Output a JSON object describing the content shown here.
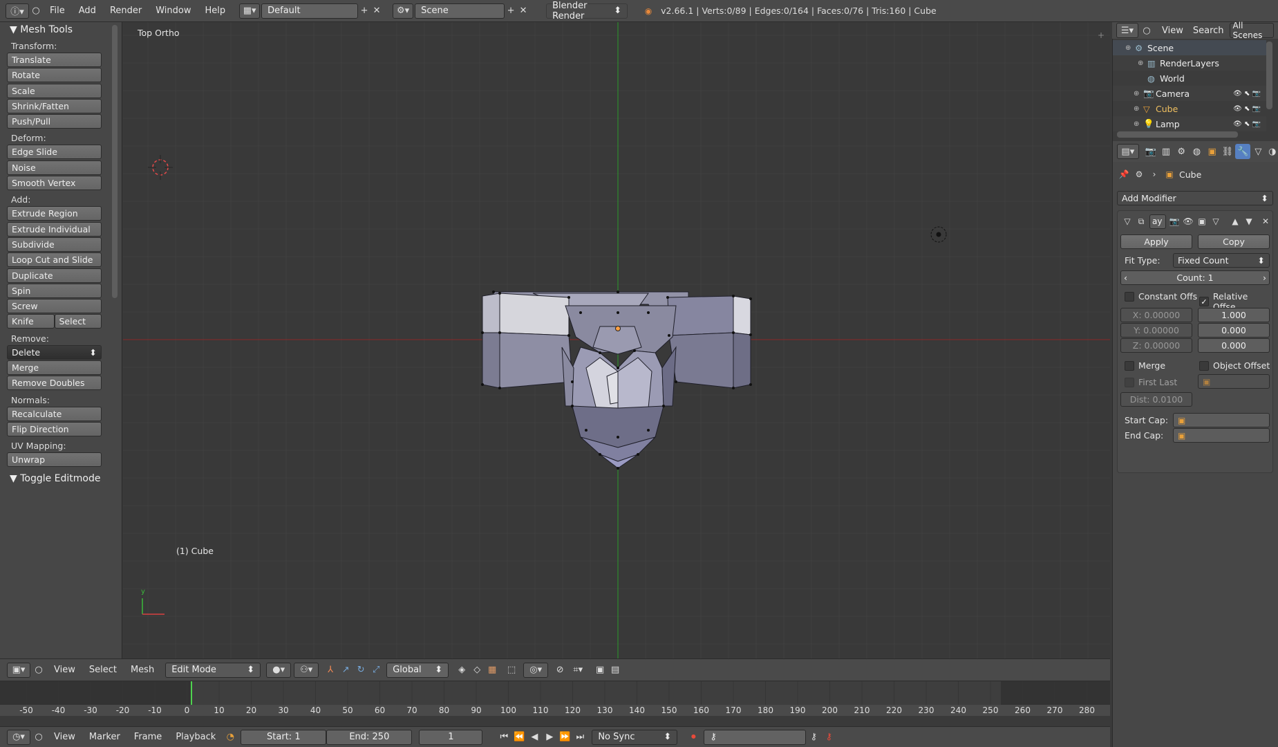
{
  "topbar": {
    "menus": [
      "File",
      "Add",
      "Render",
      "Window",
      "Help"
    ],
    "screen_layout": "Default",
    "scene": "Scene",
    "render_engine": "Blender Render",
    "stats": "v2.66.1 | Verts:0/89 | Edges:0/164 | Faces:0/76 | Tris:160 | Cube"
  },
  "toolshelf": {
    "title": "Mesh Tools",
    "sections": [
      {
        "label": "Transform:",
        "buttons": [
          "Translate",
          "Rotate",
          "Scale",
          "Shrink/Fatten",
          "Push/Pull"
        ]
      },
      {
        "label": "Deform:",
        "buttons": [
          "Edge Slide",
          "Noise",
          "Smooth Vertex"
        ]
      },
      {
        "label": "Add:",
        "buttons": [
          "Extrude Region",
          "Extrude Individual",
          "Subdivide",
          "Loop Cut and Slide",
          "Duplicate",
          "Spin",
          "Screw"
        ],
        "row": [
          "Knife",
          "Select"
        ]
      },
      {
        "label": "Remove:",
        "dropdown": "Delete",
        "buttons": [
          "Merge",
          "Remove Doubles"
        ]
      },
      {
        "label": "Normals:",
        "buttons": [
          "Recalculate",
          "Flip Direction"
        ]
      },
      {
        "label": "UV Mapping:",
        "buttons": [
          "Unwrap"
        ]
      }
    ],
    "footer": "Toggle Editmode"
  },
  "viewport": {
    "view_name": "Top Ortho",
    "object_label": "(1) Cube",
    "axis_y": "y"
  },
  "view3d_header": {
    "menus": [
      "View",
      "Select",
      "Mesh"
    ],
    "mode": "Edit Mode",
    "orientation": "Global"
  },
  "timeline": {
    "ticks": [
      "-50",
      "-40",
      "-30",
      "-20",
      "-10",
      "0",
      "10",
      "20",
      "30",
      "40",
      "50",
      "60",
      "70",
      "80",
      "90",
      "100",
      "110",
      "120",
      "130",
      "140",
      "150",
      "160",
      "170",
      "180",
      "190",
      "200",
      "210",
      "220",
      "230",
      "240",
      "250",
      "260",
      "270",
      "280"
    ],
    "menus": [
      "View",
      "Marker",
      "Frame",
      "Playback"
    ],
    "start": "Start: 1",
    "end": "End: 250",
    "current": "1",
    "sync": "No Sync"
  },
  "outliner": {
    "menus": [
      "View",
      "Search"
    ],
    "filter": "All Scenes",
    "items": [
      "Scene",
      "RenderLayers",
      "World",
      "Camera",
      "Cube",
      "Lamp"
    ]
  },
  "properties": {
    "object_name": "Cube",
    "add_modifier": "Add Modifier",
    "modifier_name": "ay",
    "apply": "Apply",
    "copy": "Copy",
    "fit_type_label": "Fit Type:",
    "fit_type": "Fixed Count",
    "count": "Count: 1",
    "constant_offset": "Constant Offs",
    "relative_offset": "Relative Offse",
    "const_x": "X: 0.00000",
    "const_y": "Y: 0.00000",
    "const_z": "Z: 0.00000",
    "rel_x": "1.000",
    "rel_y": "0.000",
    "rel_z": "0.000",
    "merge": "Merge",
    "object_offset": "Object Offset",
    "first_last": "First Last",
    "dist": "Dist: 0.0100",
    "start_cap": "Start Cap:",
    "end_cap": "End Cap:"
  },
  "colors": {
    "accent_blue": "#5680c2",
    "x_axis": "#8a2f2f",
    "y_axis": "#3b8a2f",
    "mesh": "#8c8ca6"
  }
}
